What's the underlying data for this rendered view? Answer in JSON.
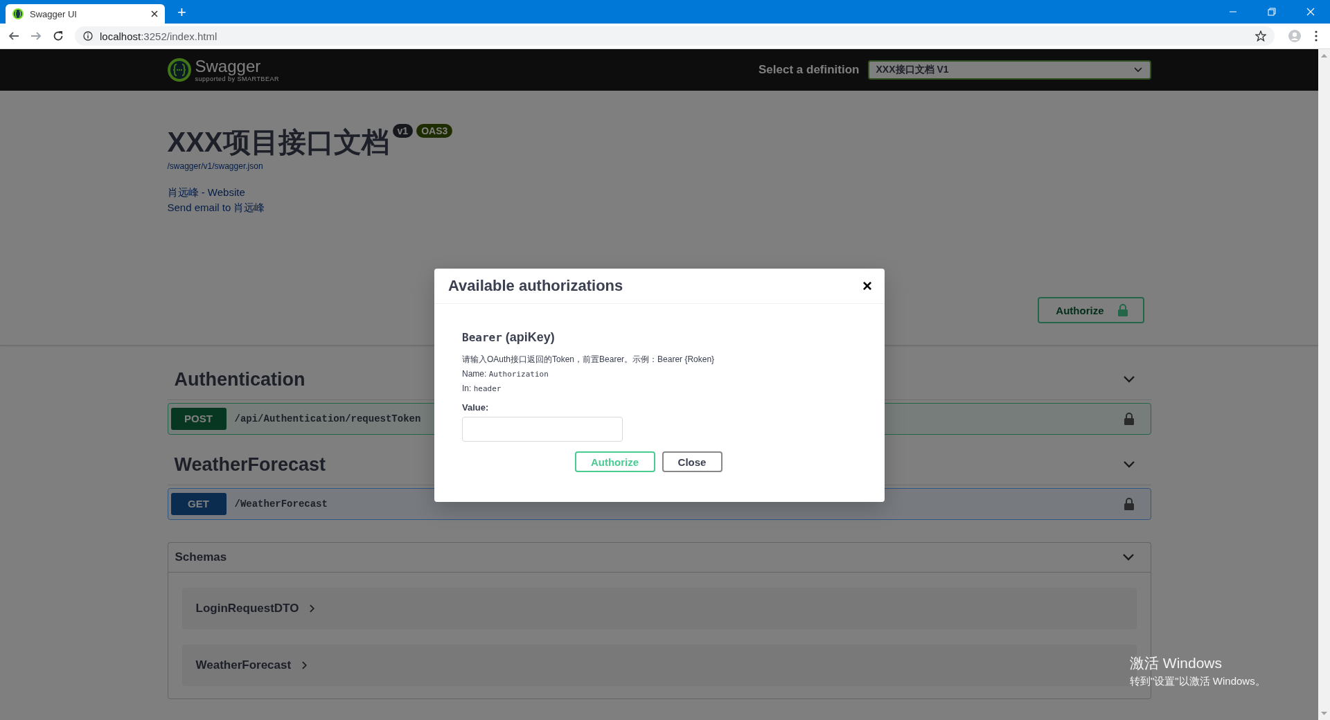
{
  "browser": {
    "tab": {
      "title": "Swagger UI",
      "selected": true
    },
    "new_tab": "+",
    "address": {
      "host": "localhost",
      "rest": ":3252/index.html"
    }
  },
  "topbar": {
    "logo_text": "Swagger",
    "logo_subtext": "supported by SMARTBEAR",
    "definition_label": "Select a definition",
    "definition_value": "XXX接口文档 V1"
  },
  "info": {
    "title": "XXX项目接口文档",
    "version": "v1",
    "oas": "OAS3",
    "spec_url": "/swagger/v1/swagger.json",
    "links": [
      "肖远峰 - Website",
      "Send email to 肖远峰"
    ]
  },
  "authorize_button": "Authorize",
  "tags": [
    {
      "name": "Authentication",
      "expanded": true,
      "operations": [
        {
          "method": "POST",
          "kind": "post",
          "path": "/api/Authentication/requestToken"
        }
      ]
    },
    {
      "name": "WeatherForecast",
      "expanded": true,
      "operations": [
        {
          "method": "GET",
          "kind": "get",
          "path": "/WeatherForecast"
        }
      ]
    }
  ],
  "schemas": {
    "title": "Schemas",
    "expanded": true,
    "items": [
      {
        "name": "LoginRequestDTO",
        "expanded": false
      },
      {
        "name": "WeatherForecast",
        "expanded": false
      }
    ]
  },
  "modal": {
    "title": "Available authorizations",
    "close": "×",
    "scheme_name": "Bearer",
    "scheme_type": "(apiKey)",
    "description": "请输入OAuth接口返回的Token，前置Bearer。示例：Bearer {Roken}",
    "name_label": "Name:",
    "name_value": "Authorization",
    "in_label": "In:",
    "in_value": "header",
    "value_label": "Value:",
    "buttons": [
      {
        "kind": "authorize",
        "label": "Authorize"
      },
      {
        "kind": "close",
        "label": "Close"
      }
    ]
  },
  "os_notice": {
    "title": "激活 Windows",
    "text": "转到\"设置\"以激活 Windows。"
  }
}
